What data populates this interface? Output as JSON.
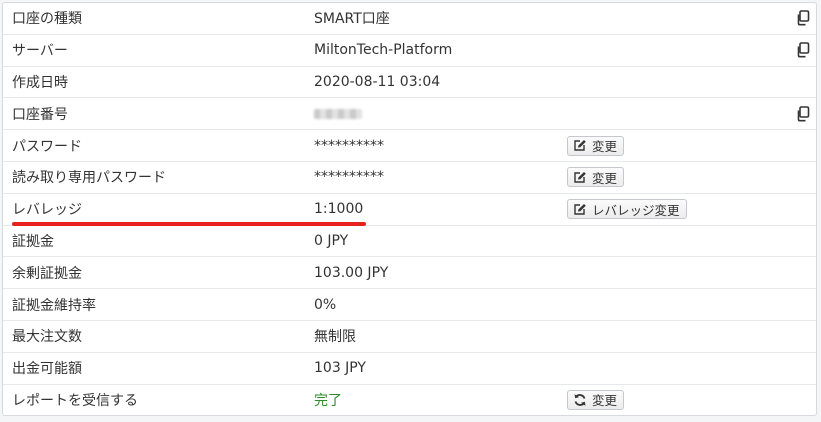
{
  "account_info": {
    "rows": [
      {
        "label": "口座の種類",
        "value": "SMART口座"
      },
      {
        "label": "サーバー",
        "value": "MiltonTech-Platform"
      },
      {
        "label": "作成日時",
        "value": "2020-08-11 03:04"
      },
      {
        "label": "口座番号",
        "value": ""
      },
      {
        "label": "パスワード",
        "value": "**********",
        "action": "変更"
      },
      {
        "label": "読み取り専用パスワード",
        "value": "**********",
        "action": "変更"
      },
      {
        "label": "レバレッジ",
        "value": "1:1000",
        "action": "レバレッジ変更"
      },
      {
        "label": "証拠金",
        "value": "0 JPY"
      },
      {
        "label": "余剰証拠金",
        "value": "103.00 JPY"
      },
      {
        "label": "証拠金維持率",
        "value": "0%"
      },
      {
        "label": "最大注文数",
        "value": "無制限"
      },
      {
        "label": "出金可能額",
        "value": "103 JPY"
      },
      {
        "label": "レポートを受信する",
        "value": "完了",
        "action": "変更"
      }
    ],
    "icons": {
      "copy": "copy-icon",
      "edit": "edit-icon",
      "refresh": "refresh-icon"
    },
    "colors": {
      "highlight": "#e5221c",
      "success": "#2e8b2e"
    }
  }
}
